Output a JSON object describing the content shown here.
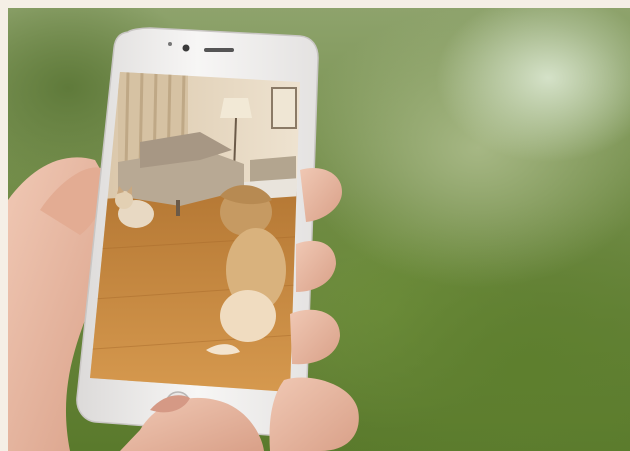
{
  "scene": {
    "colors": {
      "page_border": "#f5efe6",
      "background_green": "#6f8a44",
      "phone_body": "#f4f2f1",
      "skin": "#e8b9a2",
      "floor": "#c9893f",
      "wall": "#e9dcc8",
      "sofa": "#b8a994",
      "cat_fur": "#e6c79a"
    },
    "icons": [
      "phone-camera-icon",
      "phone-speaker-icon",
      "home-button-icon"
    ]
  }
}
